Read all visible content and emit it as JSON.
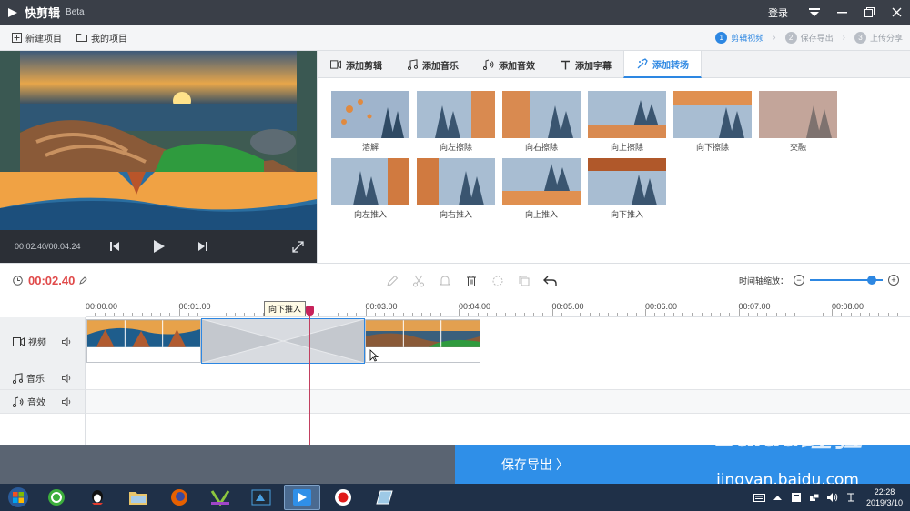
{
  "app": {
    "name": "快剪辑",
    "beta": "Beta",
    "login": "登录"
  },
  "toolbar": {
    "new_project": "新建项目",
    "my_projects": "我的项目",
    "steps": [
      {
        "num": "1",
        "label": "剪辑视频",
        "active": true
      },
      {
        "num": "2",
        "label": "保存导出",
        "active": false
      },
      {
        "num": "3",
        "label": "上传分享",
        "active": false
      }
    ]
  },
  "preview": {
    "time": "00:02.40/00:04.24"
  },
  "panel": {
    "tabs": [
      {
        "label": "添加剪辑",
        "icon": "video-camera-icon"
      },
      {
        "label": "添加音乐",
        "icon": "music-note-icon"
      },
      {
        "label": "添加音效",
        "icon": "sound-effect-icon"
      },
      {
        "label": "添加字幕",
        "icon": "text-icon"
      },
      {
        "label": "添加转场",
        "icon": "transition-icon"
      }
    ],
    "transitions_row1": [
      "溶解",
      "向左擦除",
      "向右擦除",
      "向上擦除",
      "向下擦除",
      "交融"
    ],
    "transitions_row2": [
      "向左推入",
      "向右推入",
      "向上推入",
      "向下推入"
    ]
  },
  "timeline": {
    "current_time": "00:02.40",
    "zoom_label": "时间轴缩放：",
    "zoom_level": 0.9,
    "ruler": [
      "00:00.00",
      "00:01.00",
      "00:02.00",
      "00:03.00",
      "00:04.00",
      "00:05.00",
      "00:06.00",
      "00:07.00",
      "00:08.00"
    ],
    "tracks": {
      "video": "视频",
      "music": "音乐",
      "sfx": "音效"
    },
    "tooltip": "向下推入"
  },
  "bottom": {
    "save_export": "保存导出 〉"
  },
  "watermark": {
    "brand": "Baidu经验",
    "url": "jingyan.baidu.com"
  },
  "taskbar": {
    "time": "22:28",
    "date": "2019/3/10"
  },
  "colors": {
    "accent": "#2d87e2",
    "titlebar": "#3a3f48",
    "save_button": "#2f8fe8",
    "current_time": "#e04a4a"
  }
}
